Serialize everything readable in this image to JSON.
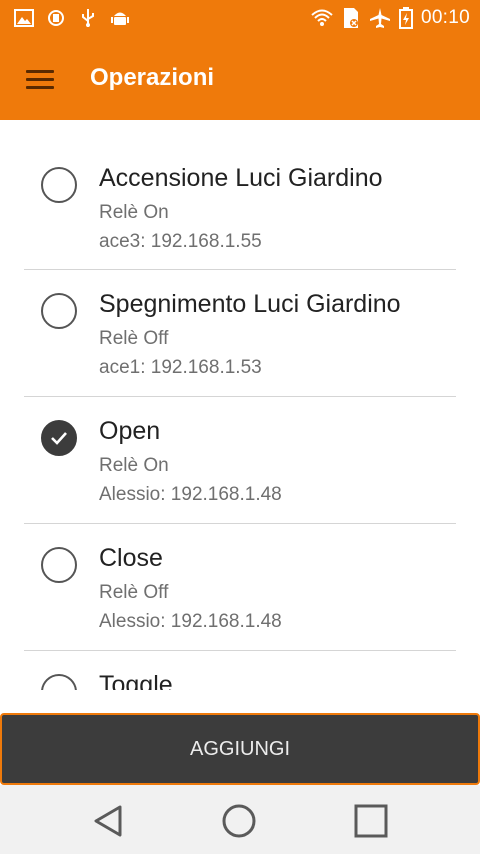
{
  "status_bar": {
    "time": "00:10",
    "left_icons": [
      "image-icon",
      "sync-icon",
      "usb-icon",
      "android-icon"
    ],
    "right_icons": [
      "wifi-icon",
      "sd-card-icon",
      "airplane-icon",
      "battery-charging-icon"
    ]
  },
  "app_bar": {
    "title": "Operazioni",
    "menu_icon": "hamburger-menu-icon"
  },
  "operations": [
    {
      "title": "Accensione Luci Giardino",
      "subtitle": "Relè On",
      "detail": "ace3: 192.168.1.55",
      "selected": false
    },
    {
      "title": "Spegnimento Luci Giardino",
      "subtitle": "Relè Off",
      "detail": "ace1: 192.168.1.53",
      "selected": false
    },
    {
      "title": "Open",
      "subtitle": "Relè On",
      "detail": "Alessio: 192.168.1.48",
      "selected": true
    },
    {
      "title": "Close",
      "subtitle": "Relè Off",
      "detail": "Alessio: 192.168.1.48",
      "selected": false
    },
    {
      "title": "Toggle",
      "selected": false
    }
  ],
  "add_button": {
    "label": "AGGIUNGI"
  },
  "nav_bar": {
    "icons": [
      "back-icon",
      "home-icon",
      "recents-icon"
    ]
  },
  "colors": {
    "primary": "#ef7a0b",
    "button_bg": "#3c3c3c",
    "nav_bg": "#f1f1f1"
  }
}
